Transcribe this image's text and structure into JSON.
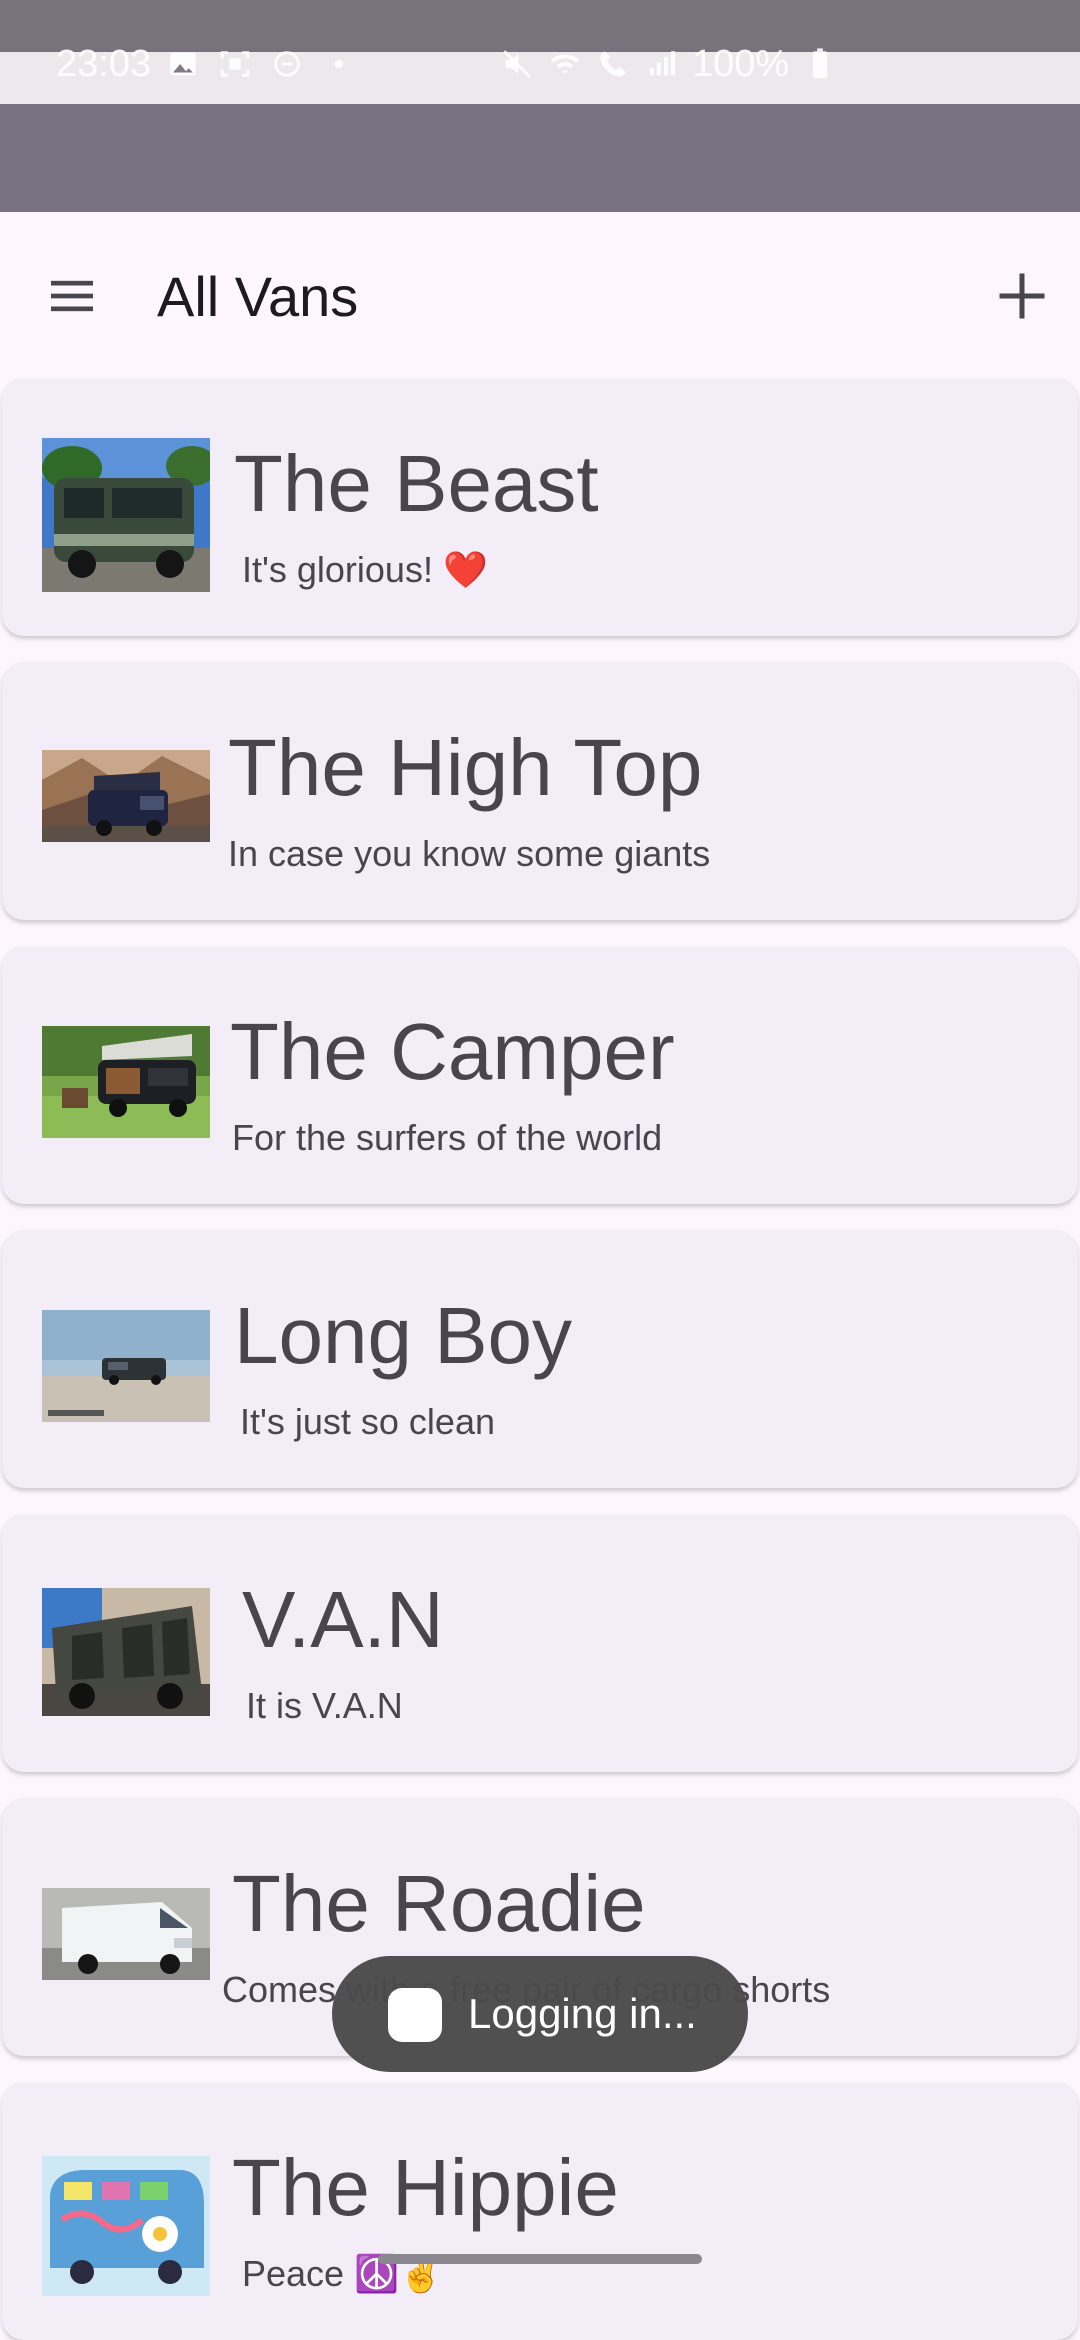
{
  "status_bar": {
    "time": "23:03",
    "battery": "100%"
  },
  "app_bar": {
    "title": "All Vans",
    "menu_icon": "menu-icon",
    "add_icon": "add-icon"
  },
  "vans": [
    {
      "title": "The Beast",
      "subtitle": "It's glorious! ❤️"
    },
    {
      "title": "The High Top",
      "subtitle": "In case you know some giants"
    },
    {
      "title": "The Camper",
      "subtitle": "For the surfers of the world"
    },
    {
      "title": "Long Boy",
      "subtitle": "It's just so clean"
    },
    {
      "title": "V.A.N",
      "subtitle": "It is V.A.N"
    },
    {
      "title": "The Roadie",
      "subtitle": "Comes with a free pair of cargo shorts"
    },
    {
      "title": "The Hippie",
      "subtitle": "Peace ☮️✌️"
    }
  ],
  "toast": {
    "text": "Logging in..."
  },
  "colors": {
    "background": "#fdf7fd",
    "card": "#f3edf7",
    "text": "#49454f",
    "toast": "#4a4a4a"
  }
}
